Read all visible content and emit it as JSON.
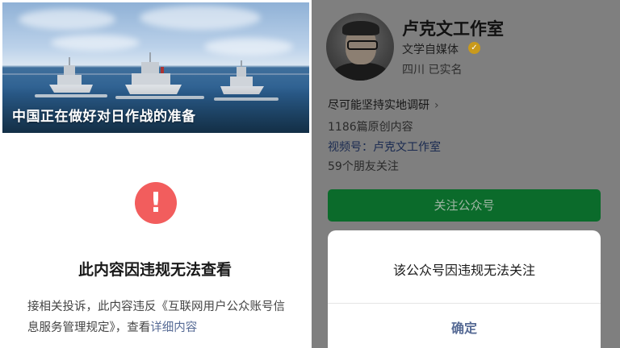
{
  "article": {
    "headline": "中国正在做好对日作战的准备",
    "blocked_title": "此内容因违规无法查看",
    "notice_text": "接相关投诉，此内容违反《互联网用户公众账号信息服务管理规定》，查看",
    "notice_link": "详细内容",
    "warn_icon": "exclamation-icon",
    "colors": {
      "warn": "#f25d5d",
      "link": "#576b95"
    }
  },
  "profile": {
    "name": "卢克文工作室",
    "type": "文学自媒体",
    "verified_icon": "verified-badge-icon",
    "location": "四川 已实名",
    "bio": "尽可能坚持实地调研",
    "bio_chevron": "›",
    "articles": "1186篇原创内容",
    "channel": "视频号：卢克文工作室",
    "friends": "59个朋友关注",
    "follow_button": "关注公众号",
    "colors": {
      "follow": "#0b6b2b"
    }
  },
  "dialog": {
    "message": "该公众号因违规无法关注",
    "confirm": "确定"
  }
}
